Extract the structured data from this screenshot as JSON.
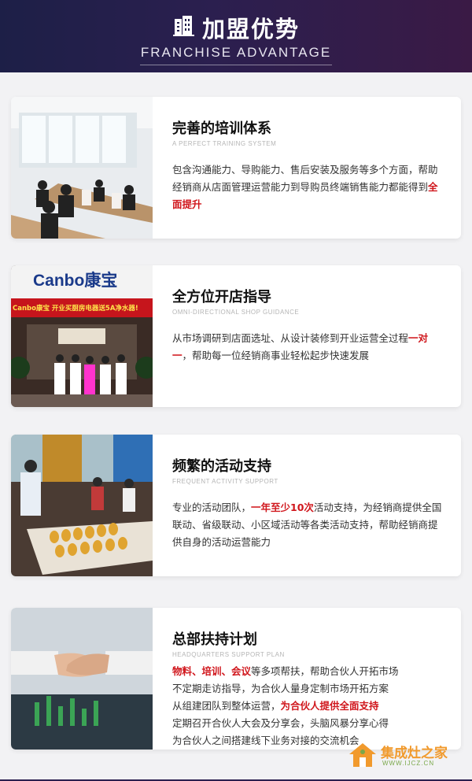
{
  "header": {
    "title": "加盟优势",
    "subtitle": "FRANCHISE ADVANTAGE",
    "icon": "building-icon"
  },
  "cards": [
    {
      "title": "完善的培训体系",
      "subtitle_en": "A PERFECT TRAINING SYSTEM",
      "desc_parts": [
        {
          "text": "包含沟通能力、导购能力、售后安装及服务等多个方面，帮助经销",
          "red": false
        },
        {
          "text": "商从店面管理运营能力到导购员终端销售能力都能得到",
          "red": false
        },
        {
          "text": "全面提升",
          "red": true
        }
      ]
    },
    {
      "title": "全方位开店指导",
      "subtitle_en": "OMNI-DIRECTIONAL SHOP GUIDANCE",
      "desc_parts": [
        {
          "text": "从市场调研到店面选址、从设计装修到开业运营全过程",
          "red": false
        },
        {
          "text": "一对一",
          "red": true
        },
        {
          "text": "，帮助每一位经销商事业轻松起步快速发展",
          "red": false
        }
      ],
      "photo_sign": "Canbo康宝",
      "photo_banner": "Canbo康宝 开业买厨房电器送5A净水器!"
    },
    {
      "title": "频繁的活动支持",
      "subtitle_en": "FREQUENT ACTIVITY SUPPORT",
      "desc_parts": [
        {
          "text": "专业的活动团队，",
          "red": false
        },
        {
          "text": "一年至少10次",
          "red": true
        },
        {
          "text": "活动支持，为经销商提供全国联动、省级联动、小区域活动等各类活动支持，帮助经销商提供自身的活动运营能力",
          "red": false
        }
      ]
    },
    {
      "title": "总部扶持计划",
      "subtitle_en": "HEADQUARTERS SUPPORT PLAN",
      "lines": [
        [
          {
            "text": "物料、培训、会议",
            "red": true
          },
          {
            "text": "等多项帮扶，帮助合伙人开拓市场",
            "red": false
          }
        ],
        [
          {
            "text": "不定期走访指导，为合伙人量身定制市场开拓方案",
            "red": false
          }
        ],
        [
          {
            "text": "从组建团队到整体运营，",
            "red": false
          },
          {
            "text": "为合伙人提供全面支持",
            "red": true
          }
        ],
        [
          {
            "text": "定期召开合伙人大会及分享会，头脑风暴分享心得",
            "red": false
          }
        ],
        [
          {
            "text": "为合伙人之间搭建线下业务对接的交流机会",
            "red": false
          }
        ]
      ]
    }
  ],
  "watermark": {
    "text": "集成灶之家",
    "url": "WWW.IJCZ.CN"
  },
  "colors": {
    "header_bg": "#221f4a",
    "accent_red": "#d0161c",
    "watermark_orange": "#f19a2d"
  }
}
